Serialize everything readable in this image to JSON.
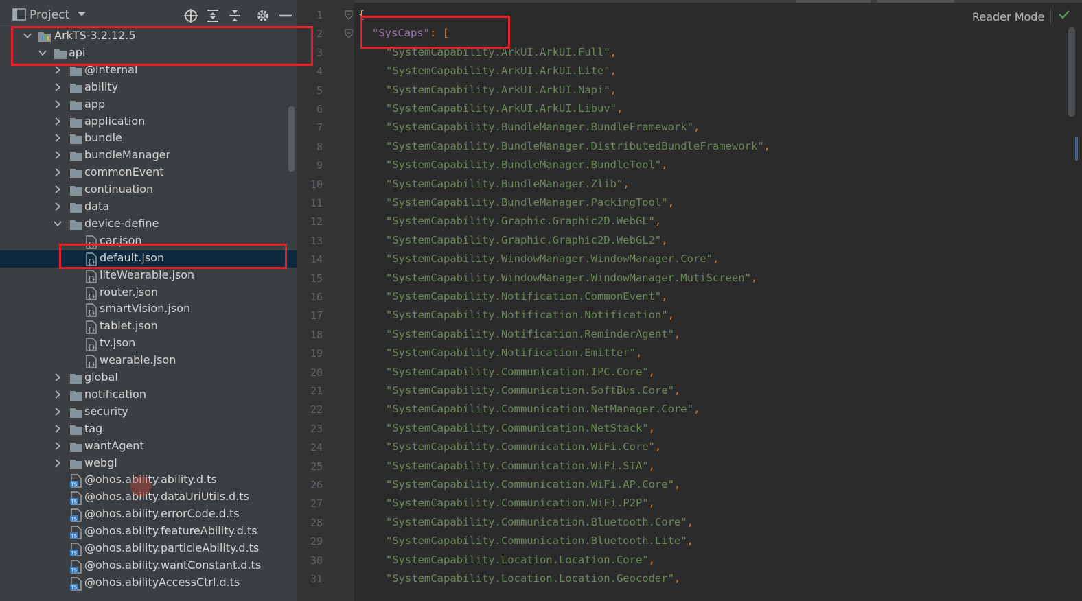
{
  "panel": {
    "title": "Project"
  },
  "tree": [
    {
      "label": "ArkTS-3.2.12.5",
      "type": "module",
      "depth": 0,
      "expanded": true
    },
    {
      "label": "api",
      "type": "folder",
      "depth": 1,
      "expanded": true
    },
    {
      "label": "@internal",
      "type": "folder",
      "depth": 2,
      "expanded": false
    },
    {
      "label": "ability",
      "type": "folder",
      "depth": 2,
      "expanded": false
    },
    {
      "label": "app",
      "type": "folder",
      "depth": 2,
      "expanded": false
    },
    {
      "label": "application",
      "type": "folder",
      "depth": 2,
      "expanded": false
    },
    {
      "label": "bundle",
      "type": "folder",
      "depth": 2,
      "expanded": false
    },
    {
      "label": "bundleManager",
      "type": "folder",
      "depth": 2,
      "expanded": false
    },
    {
      "label": "commonEvent",
      "type": "folder",
      "depth": 2,
      "expanded": false
    },
    {
      "label": "continuation",
      "type": "folder",
      "depth": 2,
      "expanded": false
    },
    {
      "label": "data",
      "type": "folder",
      "depth": 2,
      "expanded": false
    },
    {
      "label": "device-define",
      "type": "folder",
      "depth": 2,
      "expanded": true
    },
    {
      "label": "car.json",
      "type": "json",
      "depth": 3
    },
    {
      "label": "default.json",
      "type": "json",
      "depth": 3,
      "selected": true
    },
    {
      "label": "liteWearable.json",
      "type": "json",
      "depth": 3
    },
    {
      "label": "router.json",
      "type": "json",
      "depth": 3
    },
    {
      "label": "smartVision.json",
      "type": "json",
      "depth": 3
    },
    {
      "label": "tablet.json",
      "type": "json",
      "depth": 3
    },
    {
      "label": "tv.json",
      "type": "json",
      "depth": 3
    },
    {
      "label": "wearable.json",
      "type": "json",
      "depth": 3
    },
    {
      "label": "global",
      "type": "folder",
      "depth": 2,
      "expanded": false
    },
    {
      "label": "notification",
      "type": "folder",
      "depth": 2,
      "expanded": false
    },
    {
      "label": "security",
      "type": "folder",
      "depth": 2,
      "expanded": false
    },
    {
      "label": "tag",
      "type": "folder",
      "depth": 2,
      "expanded": false
    },
    {
      "label": "wantAgent",
      "type": "folder",
      "depth": 2,
      "expanded": false
    },
    {
      "label": "webgl",
      "type": "folder",
      "depth": 2,
      "expanded": false
    },
    {
      "label": "@ohos.ability.ability.d.ts",
      "type": "ts",
      "depth": 2
    },
    {
      "label": "@ohos.ability.dataUriUtils.d.ts",
      "type": "ts",
      "depth": 2
    },
    {
      "label": "@ohos.ability.errorCode.d.ts",
      "type": "ts",
      "depth": 2
    },
    {
      "label": "@ohos.ability.featureAbility.d.ts",
      "type": "ts",
      "depth": 2
    },
    {
      "label": "@ohos.ability.particleAbility.d.ts",
      "type": "ts",
      "depth": 2
    },
    {
      "label": "@ohos.ability.wantConstant.d.ts",
      "type": "ts",
      "depth": 2
    },
    {
      "label": "@ohos.abilityAccessCtrl.d.ts",
      "type": "ts",
      "depth": 2
    }
  ],
  "editor": {
    "reader_mode_label": "Reader Mode",
    "lines": [
      {
        "n": "1",
        "kind": "open"
      },
      {
        "n": "2",
        "kind": "key",
        "key": "\"SysCaps\"",
        "rest": ": ["
      },
      {
        "n": "3",
        "kind": "val",
        "text": "\"SystemCapability.ArkUI.ArkUI.Full\""
      },
      {
        "n": "4",
        "kind": "val",
        "text": "\"SystemCapability.ArkUI.ArkUI.Lite\""
      },
      {
        "n": "5",
        "kind": "val",
        "text": "\"SystemCapability.ArkUI.ArkUI.Napi\""
      },
      {
        "n": "6",
        "kind": "val",
        "text": "\"SystemCapability.ArkUI.ArkUI.Libuv\""
      },
      {
        "n": "7",
        "kind": "val",
        "text": "\"SystemCapability.BundleManager.BundleFramework\""
      },
      {
        "n": "8",
        "kind": "val",
        "text": "\"SystemCapability.BundleManager.DistributedBundleFramework\""
      },
      {
        "n": "9",
        "kind": "val",
        "text": "\"SystemCapability.BundleManager.BundleTool\""
      },
      {
        "n": "10",
        "kind": "val",
        "text": "\"SystemCapability.BundleManager.Zlib\""
      },
      {
        "n": "11",
        "kind": "val",
        "text": "\"SystemCapability.BundleManager.PackingTool\""
      },
      {
        "n": "12",
        "kind": "val",
        "text": "\"SystemCapability.Graphic.Graphic2D.WebGL\""
      },
      {
        "n": "13",
        "kind": "val",
        "text": "\"SystemCapability.Graphic.Graphic2D.WebGL2\""
      },
      {
        "n": "14",
        "kind": "val",
        "text": "\"SystemCapability.WindowManager.WindowManager.Core\""
      },
      {
        "n": "15",
        "kind": "val",
        "text": "\"SystemCapability.WindowManager.WindowManager.MutiScreen\""
      },
      {
        "n": "16",
        "kind": "val",
        "text": "\"SystemCapability.Notification.CommonEvent\""
      },
      {
        "n": "17",
        "kind": "val",
        "text": "\"SystemCapability.Notification.Notification\""
      },
      {
        "n": "18",
        "kind": "val",
        "text": "\"SystemCapability.Notification.ReminderAgent\""
      },
      {
        "n": "19",
        "kind": "val",
        "text": "\"SystemCapability.Notification.Emitter\""
      },
      {
        "n": "20",
        "kind": "val",
        "text": "\"SystemCapability.Communication.IPC.Core\""
      },
      {
        "n": "21",
        "kind": "val",
        "text": "\"SystemCapability.Communication.SoftBus.Core\""
      },
      {
        "n": "22",
        "kind": "val",
        "text": "\"SystemCapability.Communication.NetManager.Core\""
      },
      {
        "n": "23",
        "kind": "val",
        "text": "\"SystemCapability.Communication.NetStack\""
      },
      {
        "n": "24",
        "kind": "val",
        "text": "\"SystemCapability.Communication.WiFi.Core\""
      },
      {
        "n": "25",
        "kind": "val",
        "text": "\"SystemCapability.Communication.WiFi.STA\""
      },
      {
        "n": "26",
        "kind": "val",
        "text": "\"SystemCapability.Communication.WiFi.AP.Core\""
      },
      {
        "n": "27",
        "kind": "val",
        "text": "\"SystemCapability.Communication.WiFi.P2P\""
      },
      {
        "n": "28",
        "kind": "val",
        "text": "\"SystemCapability.Communication.Bluetooth.Core\""
      },
      {
        "n": "29",
        "kind": "val",
        "text": "\"SystemCapability.Communication.Bluetooth.Lite\""
      },
      {
        "n": "30",
        "kind": "val",
        "text": "\"SystemCapability.Location.Location.Core\""
      },
      {
        "n": "31",
        "kind": "val",
        "text": "\"SystemCapability.Location.Location.Geocoder\""
      }
    ]
  },
  "colors": {
    "panel_bg": "#3c3f41",
    "editor_bg": "#2b2b2b",
    "selection": "#0d293e",
    "string": "#6a8759",
    "key": "#9876aa",
    "punct": "#cc7832",
    "annotation": "#e8202a",
    "check": "#499c54"
  },
  "icons": {
    "panel": "project-view-icon",
    "dropdown": "chevron-down-icon",
    "locate": "locate-crosshair-icon",
    "expand": "expand-all-icon",
    "collapse": "collapse-all-icon",
    "settings": "gear-icon",
    "hide": "minimize-icon",
    "check": "check-icon"
  }
}
